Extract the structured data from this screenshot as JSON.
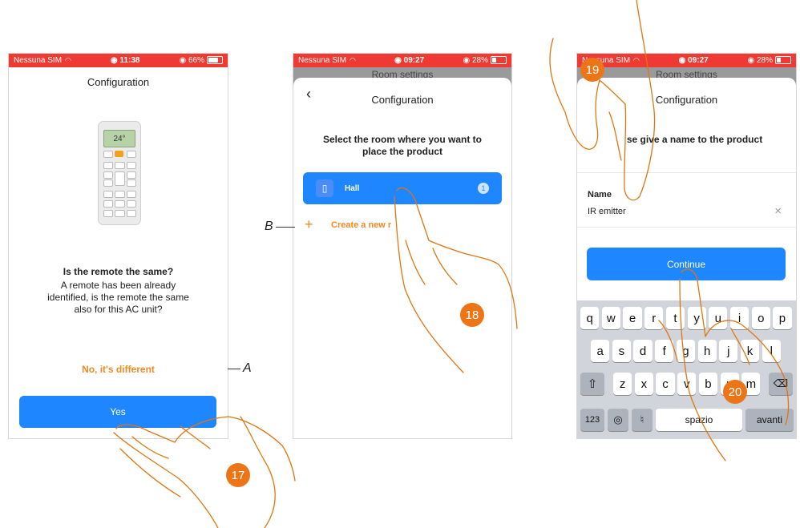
{
  "phone1": {
    "status": {
      "carrier": "Nessuna SIM",
      "time": "11:38",
      "battery": "66%"
    },
    "title": "Configuration",
    "remote_display": "24°",
    "question": "Is the remote the same?",
    "description": "A remote has been already identified, is the remote the same also for this AC unit?",
    "secondary_link": "No, it's different",
    "primary_button": "Yes"
  },
  "phone2": {
    "status": {
      "carrier": "Nessuna SIM",
      "time": "09:27",
      "battery": "28%"
    },
    "behind_title": "Room settings",
    "title": "Configuration",
    "instruction": "Select the room where you want to place the product",
    "room": {
      "name": "Hall",
      "count": "1"
    },
    "create_link": "Create a new r"
  },
  "phone3": {
    "status": {
      "carrier": "Nessuna SIM",
      "time": "09:27",
      "battery": "28%"
    },
    "behind_title": "Room settings",
    "title": "Configuration",
    "instruction": "se give a name to the product",
    "name_label": "Name",
    "name_value": "IR emitter",
    "continue_button": "Continue",
    "keyboard": {
      "row1": [
        "q",
        "w",
        "e",
        "r",
        "t",
        "y",
        "u",
        "i",
        "o",
        "p"
      ],
      "row2": [
        "a",
        "s",
        "d",
        "f",
        "g",
        "h",
        "j",
        "k",
        "l"
      ],
      "row3": [
        "z",
        "x",
        "c",
        "v",
        "b",
        "n",
        "m"
      ],
      "num": "123",
      "space": "spazio",
      "enter": "avanti"
    }
  },
  "callouts": {
    "a": "A",
    "b": "B"
  },
  "steps": [
    "17",
    "18",
    "19",
    "20"
  ]
}
